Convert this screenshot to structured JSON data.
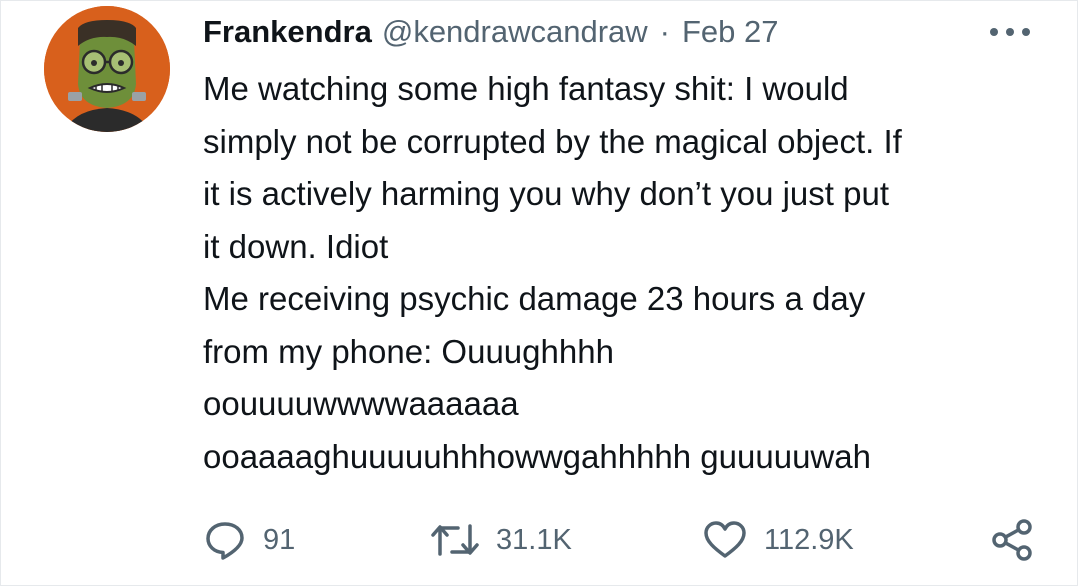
{
  "tweet": {
    "author": {
      "name": "Frankendra",
      "handle": "@kendrawcandraw",
      "avatar_icon": "frankenstein-avatar"
    },
    "separator": "·",
    "date": "Feb 27",
    "more_icon": "more-dots-icon",
    "text_lines": [
      "Me watching some high fantasy shit: I would",
      "simply not be corrupted by the magical object. If",
      "it is actively harming you why don’t you just put",
      "it down. Idiot",
      "Me receiving psychic damage 23 hours a day",
      "from my phone: Ouuughhhh",
      "oouuuuwwwwaaaaaa",
      "ooaaaaghuuuuuhhhowwgahhhhh guuuuuwah"
    ],
    "actions": {
      "reply": {
        "icon": "reply-icon",
        "count": "91"
      },
      "retweet": {
        "icon": "retweet-icon",
        "count": "31.1K"
      },
      "like": {
        "icon": "heart-icon",
        "count": "112.9K"
      },
      "share": {
        "icon": "share-icon"
      }
    }
  },
  "colors": {
    "text": "#0f1419",
    "secondary": "#536471",
    "avatar_bg": "#d8601c",
    "border": "#e6e9ec"
  }
}
